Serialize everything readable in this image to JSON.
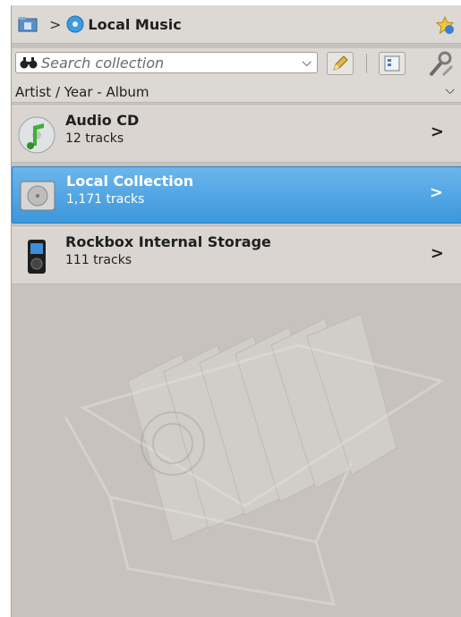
{
  "breadcrumb": {
    "separator": ">",
    "title": "Local Music"
  },
  "search": {
    "placeholder": "Search collection",
    "value": ""
  },
  "sort": {
    "label": "Artist / Year - Album"
  },
  "collections": [
    {
      "title": "Audio CD",
      "subtitle": "12 tracks",
      "icon": "audio-cd-icon"
    },
    {
      "title": "Local Collection",
      "subtitle": "1,171 tracks",
      "icon": "hard-drive-icon",
      "selected": true
    },
    {
      "title": "Rockbox Internal Storage",
      "subtitle": "111 tracks",
      "icon": "media-player-device-icon"
    }
  ],
  "colors": {
    "panel_bg": "#c7c2bd",
    "selection": "#3b97db",
    "toolbar_bg": "#dcd8d3"
  }
}
